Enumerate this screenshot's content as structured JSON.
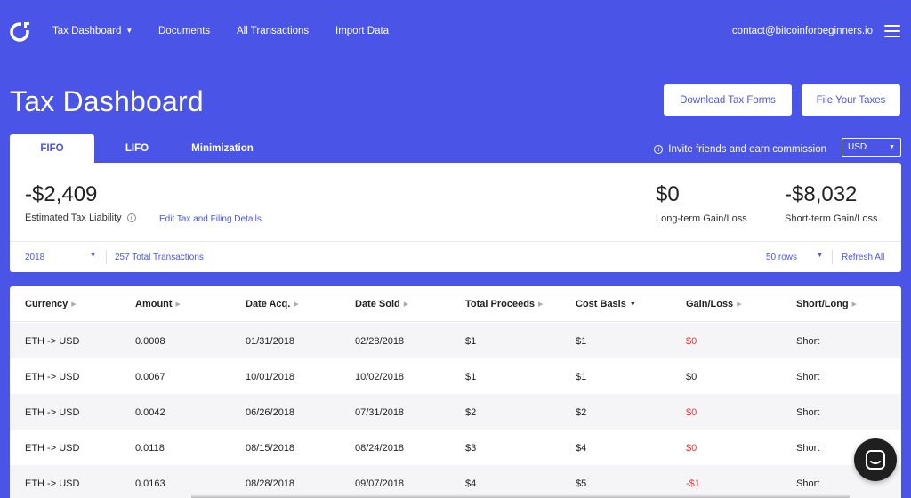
{
  "nav": {
    "links": [
      {
        "label": "Tax Dashboard",
        "has_caret": true
      },
      {
        "label": "Documents"
      },
      {
        "label": "All Transactions"
      },
      {
        "label": "Import Data"
      }
    ],
    "email": "contact@bitcoinforbeginners.io"
  },
  "header": {
    "title": "Tax Dashboard",
    "download_label": "Download Tax Forms",
    "file_label": "File Your Taxes"
  },
  "tabs": [
    {
      "label": "FIFO",
      "active": true
    },
    {
      "label": "LIFO",
      "active": false
    },
    {
      "label": "Minimization",
      "active": false
    }
  ],
  "invite": {
    "icon": "info-icon",
    "label": "Invite friends and earn commission"
  },
  "currency": {
    "selected": "USD"
  },
  "summary": {
    "liability_value": "-$2,409",
    "liability_label": "Estimated Tax Liability",
    "edit_link": "Edit Tax and Filing Details",
    "long_term_value": "$0",
    "long_term_label": "Long-term Gain/Loss",
    "short_term_value": "-$8,032",
    "short_term_label": "Short-term Gain/Loss",
    "year": "2018",
    "total_transactions": "257 Total Transactions",
    "rows": "50 rows",
    "refresh": "Refresh All"
  },
  "table": {
    "columns": [
      "Currency",
      "Amount",
      "Date Acq.",
      "Date Sold",
      "Total Proceeds",
      "Cost Basis",
      "Gain/Loss",
      "Short/Long"
    ],
    "sorted_column": "Cost Basis",
    "rows": [
      {
        "currency": "ETH -> USD",
        "amount": "0.0008",
        "date_acq": "01/31/2018",
        "date_sold": "02/28/2018",
        "proceeds": "$1",
        "cost_basis": "$1",
        "gain_loss": "$0",
        "gain_negative": true,
        "term": "Short"
      },
      {
        "currency": "ETH -> USD",
        "amount": "0.0067",
        "date_acq": "10/01/2018",
        "date_sold": "10/02/2018",
        "proceeds": "$1",
        "cost_basis": "$1",
        "gain_loss": "$0",
        "gain_negative": false,
        "term": "Short"
      },
      {
        "currency": "ETH -> USD",
        "amount": "0.0042",
        "date_acq": "06/26/2018",
        "date_sold": "07/31/2018",
        "proceeds": "$2",
        "cost_basis": "$2",
        "gain_loss": "$0",
        "gain_negative": true,
        "term": "Short"
      },
      {
        "currency": "ETH -> USD",
        "amount": "0.0118",
        "date_acq": "08/15/2018",
        "date_sold": "08/24/2018",
        "proceeds": "$3",
        "cost_basis": "$4",
        "gain_loss": "$0",
        "gain_negative": true,
        "term": "Short"
      },
      {
        "currency": "ETH -> USD",
        "amount": "0.0163",
        "date_acq": "08/28/2018",
        "date_sold": "09/07/2018",
        "proceeds": "$4",
        "cost_basis": "$5",
        "gain_loss": "-$1",
        "gain_negative": true,
        "term": "Short"
      }
    ]
  },
  "colors": {
    "brand": "#4a55e8",
    "negative": "#e03a3a"
  },
  "chat": {
    "icon": "chat-icon"
  }
}
